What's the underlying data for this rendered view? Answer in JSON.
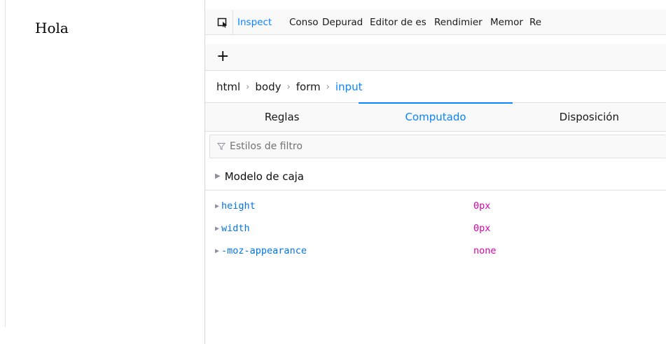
{
  "content": {
    "greeting": "Hola"
  },
  "devtools": {
    "tabs": [
      {
        "label": "Inspect",
        "selected": true
      },
      {
        "label": "Conso",
        "selected": false
      },
      {
        "label": "Depurad",
        "selected": false
      },
      {
        "label": "Editor de es",
        "selected": false
      },
      {
        "label": "Rendimier",
        "selected": false
      },
      {
        "label": "Memor",
        "selected": false
      },
      {
        "label": "Re",
        "selected": false
      }
    ],
    "toolbar": {
      "add_label": "+"
    },
    "breadcrumbs": [
      "html",
      "body",
      "form",
      "input"
    ],
    "breadcrumb_separator": "›",
    "sidebar_tabs": [
      {
        "label": "Reglas",
        "selected": false
      },
      {
        "label": "Computado",
        "selected": true
      },
      {
        "label": "Disposición",
        "selected": false
      }
    ],
    "filter": {
      "placeholder": "Estilos de filtro"
    },
    "box_model_label": "Modelo de caja",
    "computed_properties": [
      {
        "name": "height",
        "value": "0px"
      },
      {
        "name": "width",
        "value": "0px"
      },
      {
        "name": "-moz-appearance",
        "value": "none"
      }
    ]
  },
  "colors": {
    "accent": "#0a84ff",
    "property_name": "#0074e8",
    "property_value": "#dd00a9"
  },
  "icons": {
    "picker": "element-picker-icon",
    "twisty": "triangle-right-icon",
    "filter": "filter-icon"
  }
}
